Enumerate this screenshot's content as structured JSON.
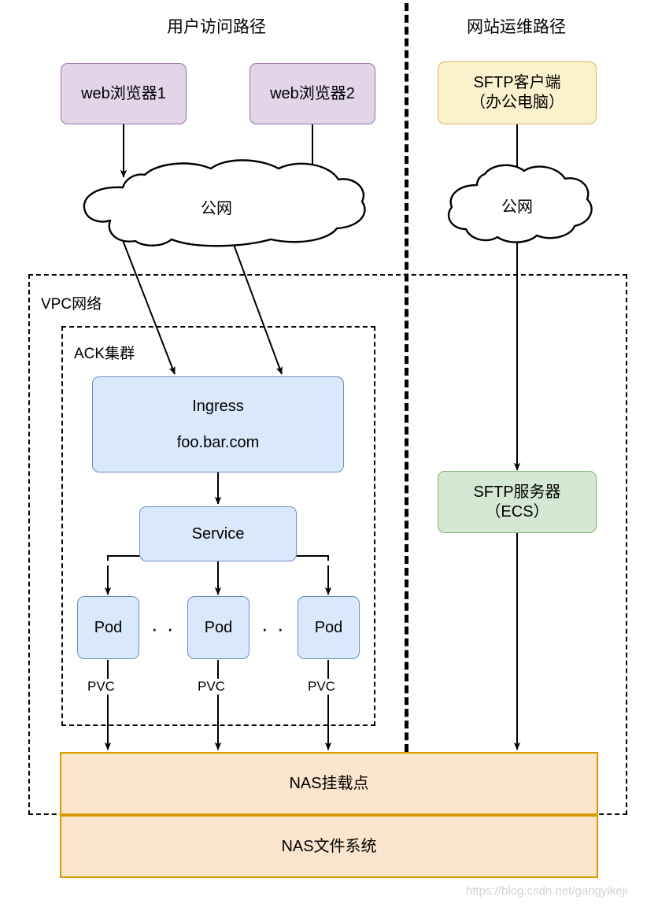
{
  "diagram": {
    "title_left": "用户访问路径",
    "title_right": "网站运维路径",
    "watermark": "https://blog.csdn.net/gangyikeji"
  },
  "nodes": {
    "browser1": {
      "label": "web浏览器1"
    },
    "browser2": {
      "label": "web浏览器2"
    },
    "sftp_client": {
      "line1": "SFTP客户端",
      "line2": "（办公电脑）"
    },
    "cloud_left": {
      "label": "公网"
    },
    "cloud_right": {
      "label": "公网"
    },
    "ingress": {
      "line1": "Ingress",
      "line2": "foo.bar.com"
    },
    "service": {
      "label": "Service"
    },
    "pod1": {
      "label": "Pod"
    },
    "pod2": {
      "label": "Pod"
    },
    "pod3": {
      "label": "Pod"
    },
    "sftp_server": {
      "line1": "SFTP服务器",
      "line2": "（ECS）"
    },
    "nas_mount": {
      "label": "NAS挂载点"
    },
    "nas_filesystem": {
      "label": "NAS文件系统"
    }
  },
  "containers": {
    "vpc": {
      "label": "VPC网络"
    },
    "ack": {
      "label": "ACK集群"
    }
  },
  "edge_labels": {
    "pvc1": "PVC",
    "pvc2": "PVC",
    "pvc3": "PVC",
    "ellipsis1": "· ·",
    "ellipsis2": "· ·"
  },
  "colors": {
    "purple_fill": "#e1d5e7",
    "purple_stroke": "#9673a6",
    "yellow_fill": "#fbf2cd",
    "yellow_stroke": "#d6b656",
    "blue_fill": "#dae8fc",
    "blue_stroke": "#6c8ebf",
    "green_fill": "#d5e8d4",
    "green_stroke": "#82b366",
    "orange_fill": "#fce5cd",
    "orange_stroke": "#d79b00",
    "line": "#000000"
  }
}
